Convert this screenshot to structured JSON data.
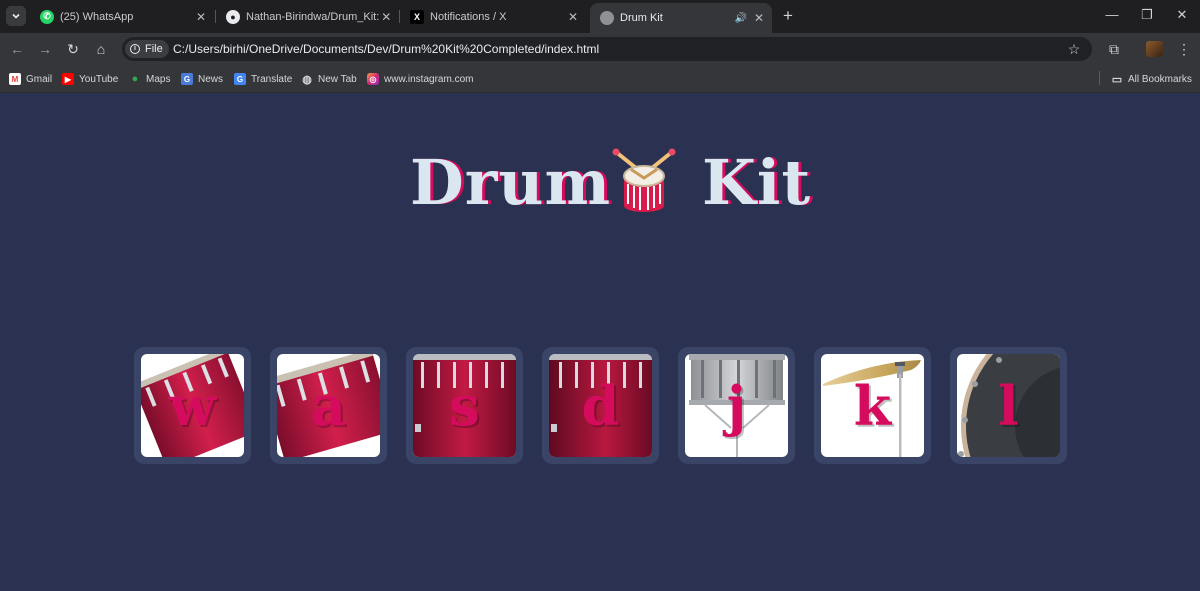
{
  "browser": {
    "tabs": [
      {
        "title": "(25) WhatsApp",
        "icon": "whatsapp-icon"
      },
      {
        "title": "Nathan-Birindwa/Drum_Kit: Dru",
        "icon": "github-icon"
      },
      {
        "title": "Notifications / X",
        "icon": "x-logo-icon"
      },
      {
        "title": "Drum Kit",
        "icon": "globe-icon",
        "active": true
      }
    ],
    "omnibox": {
      "chip_label": "File",
      "url": "C:/Users/birhi/OneDrive/Documents/Dev/Drum%20Kit%20Completed/index.html"
    },
    "bookmarks": [
      {
        "label": "Gmail",
        "icon": "gmail-icon"
      },
      {
        "label": "YouTube",
        "icon": "youtube-icon"
      },
      {
        "label": "Maps",
        "icon": "maps-icon"
      },
      {
        "label": "News",
        "icon": "news-icon"
      },
      {
        "label": "Translate",
        "icon": "translate-icon"
      },
      {
        "label": "New Tab",
        "icon": "new-tab-icon"
      },
      {
        "label": "www.instagram.com",
        "icon": "instagram-icon"
      }
    ],
    "all_bookmarks_label": "All Bookmarks"
  },
  "page": {
    "title_left": "Drum",
    "title_right": "Kit",
    "title_emoji": "drum-emoji-icon",
    "drums": [
      {
        "key": "w",
        "image": "tom-1"
      },
      {
        "key": "a",
        "image": "tom-2"
      },
      {
        "key": "s",
        "image": "tom-3"
      },
      {
        "key": "d",
        "image": "tom-4"
      },
      {
        "key": "j",
        "image": "snare"
      },
      {
        "key": "k",
        "image": "crash"
      },
      {
        "key": "l",
        "image": "kick"
      }
    ]
  },
  "colors": {
    "background": "#2b3150",
    "title_text": "#dbe7f0",
    "accent": "#d50b5e",
    "pad_frame": "#3a4466"
  }
}
